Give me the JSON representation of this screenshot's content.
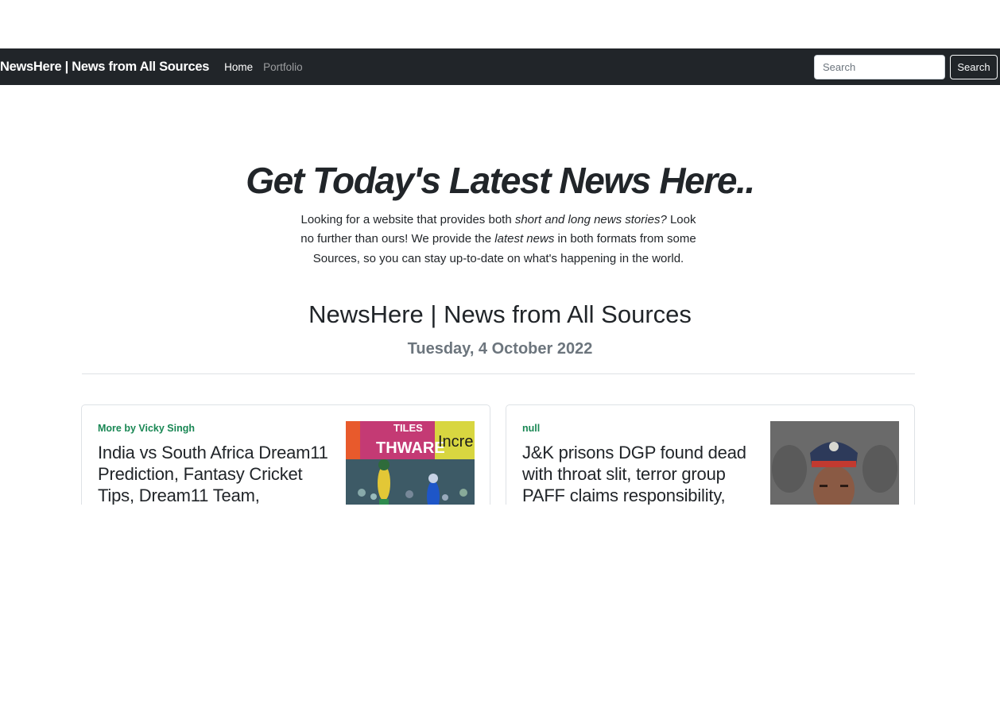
{
  "navbar": {
    "brand": "NewsHere | News from All Sources",
    "links": [
      {
        "label": "Home",
        "active": true
      },
      {
        "label": "Portfolio",
        "active": false
      }
    ],
    "search_placeholder": "Search",
    "search_button": "Search",
    "background_color": "#212529"
  },
  "hero": {
    "title": "Get Today's Latest News Here..",
    "text_parts": [
      "Looking for a website that provides both ",
      "short and long news stories?",
      " Look no further than ours! We provide the ",
      "latest news",
      " in both formats from some Sources, so you can stay up-to-date on what's happening in the world."
    ]
  },
  "site_title": "NewsHere | News from All Sources",
  "date": "Tuesday, 4 October 2022",
  "articles": [
    {
      "author": "More by Vicky Singh",
      "title": "India vs South Africa Dream11 Prediction, Fantasy Cricket Tips, Dream11 Team,",
      "image_icon": "cricket-photo"
    },
    {
      "author": "null",
      "title": "J&K prisons DGP found dead with throat slit, terror group PAFF claims responsibility,",
      "image_icon": "police-officer-photo"
    }
  ],
  "colors": {
    "author_link": "#198754",
    "date": "#6c757d"
  }
}
